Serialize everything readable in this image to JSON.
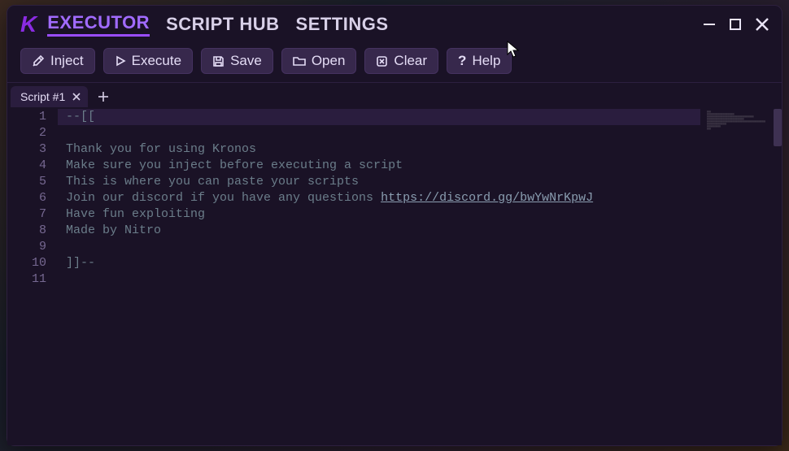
{
  "logo": "K",
  "nav": {
    "executor": "EXECUTOR",
    "script_hub": "SCRIPT HUB",
    "settings": "SETTINGS"
  },
  "toolbar": {
    "inject": "Inject",
    "execute": "Execute",
    "save": "Save",
    "open": "Open",
    "clear": "Clear",
    "help": "Help"
  },
  "tabs": {
    "tab1": "Script #1"
  },
  "editor": {
    "lines": {
      "l1": "--[[",
      "l2": "",
      "l3": "Thank you for using Kronos",
      "l4": "Make sure you inject before executing a script",
      "l5": "This is where you can paste your scripts",
      "l6a": "Join our discord if you have any questions ",
      "l6_link": "https://discord.gg/bwYwNrKpwJ",
      "l7": "Have fun exploiting",
      "l8": "Made by Nitro",
      "l9": "",
      "l10": "]]--",
      "l11": ""
    },
    "line_numbers": {
      "n1": "1",
      "n2": "2",
      "n3": "3",
      "n4": "4",
      "n5": "5",
      "n6": "6",
      "n7": "7",
      "n8": "8",
      "n9": "9",
      "n10": "10",
      "n11": "11"
    }
  }
}
